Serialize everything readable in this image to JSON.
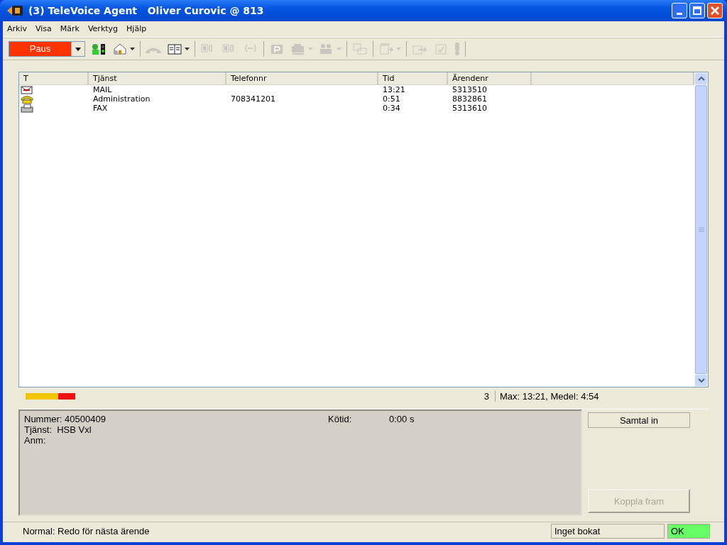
{
  "window": {
    "title": "(3) TeleVoice Agent   Oliver Curovic @ 813"
  },
  "menu": [
    "Arkiv",
    "Visa",
    "Märk",
    "Verktyg",
    "Hjälp"
  ],
  "toolbar": {
    "status": "Paus",
    "groups": [
      {
        "buttons": [
          {
            "kind": "agent",
            "disabled": false,
            "dropdown": false
          },
          {
            "kind": "home",
            "disabled": false,
            "dropdown": true
          }
        ]
      },
      {
        "buttons": [
          {
            "kind": "handset",
            "disabled": true,
            "dropdown": false
          },
          {
            "kind": "book",
            "disabled": false,
            "dropdown": true
          }
        ]
      },
      {
        "buttons": [
          {
            "kind": "line1",
            "disabled": true,
            "dropdown": false
          },
          {
            "kind": "line2",
            "disabled": true,
            "dropdown": false
          },
          {
            "kind": "conference",
            "disabled": true,
            "dropdown": false
          }
        ]
      },
      {
        "buttons": [
          {
            "kind": "park",
            "disabled": true,
            "dropdown": false
          },
          {
            "kind": "transfer",
            "disabled": true,
            "dropdown": true
          },
          {
            "kind": "group",
            "disabled": true,
            "dropdown": true
          }
        ]
      },
      {
        "buttons": [
          {
            "kind": "copy",
            "disabled": true,
            "dropdown": false
          }
        ]
      },
      {
        "buttons": [
          {
            "kind": "forward",
            "disabled": true,
            "dropdown": true
          }
        ]
      },
      {
        "buttons": [
          {
            "kind": "export",
            "disabled": true,
            "dropdown": false
          },
          {
            "kind": "check",
            "disabled": true,
            "dropdown": false
          },
          {
            "kind": "alert",
            "disabled": true,
            "dropdown": false
          }
        ]
      }
    ]
  },
  "table": {
    "columns": [
      "T",
      "Tjänst",
      "Telefonnr",
      "Tid",
      "Ärendenr"
    ],
    "rows": [
      {
        "kind": "mail",
        "service": "MAIL",
        "phone": "",
        "time": "13:21",
        "case": "5313510"
      },
      {
        "kind": "phone",
        "service": "Administration",
        "phone": "708341201",
        "time": "0:51",
        "case": "8832861"
      },
      {
        "kind": "fax",
        "service": "FAX",
        "phone": "",
        "time": "0:34",
        "case": "5313610"
      }
    ]
  },
  "summary": {
    "count": "3",
    "stats": "Max: 13:21, Medel:  4:54"
  },
  "details": {
    "number_label": "Nummer:",
    "number": "40500409",
    "service_label": "Tjänst:",
    "service": "HSB Vxl",
    "note_label": "Anm:",
    "queue_label": "Kötid:",
    "queue_time": "0:00 s"
  },
  "buttons": [
    {
      "label": "Samtal in",
      "disabled": false
    },
    {
      "label": "Koppla fram",
      "disabled": true
    }
  ],
  "status_bar": {
    "message": "Normal: Redo för nästa ärende",
    "booking": "Inget bokat",
    "state": "OK",
    "ok": true
  }
}
